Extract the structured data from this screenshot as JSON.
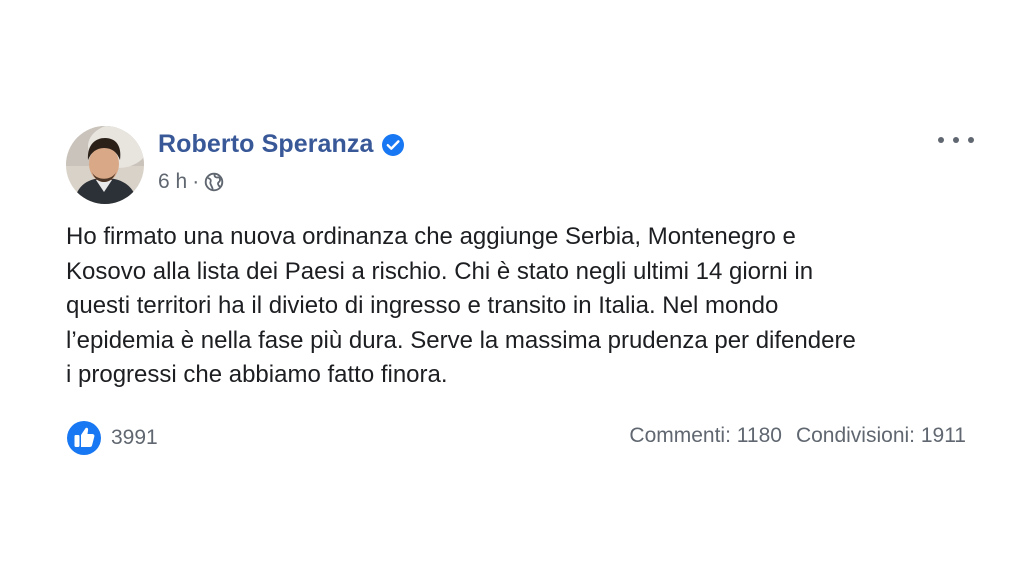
{
  "post": {
    "author_name": "Roberto Speranza",
    "verified": true,
    "time": "6 h",
    "separator": "·",
    "audience_icon": "globe-icon",
    "more_icon": "more-options-icon",
    "body_lines": [
      "Ho firmato una nuova ordinanza che aggiunge Serbia, Montenegro e",
      "Kosovo alla lista dei Paesi a rischio. Chi è stato negli ultimi 14 giorni in",
      "questi territori ha il divieto di ingresso e transito in Italia. Nel mondo",
      "l’epidemia è nella fase più dura. Serve la massima prudenza per difendere",
      "i progressi che abbiamo fatto finora."
    ]
  },
  "reactions": {
    "icon": "like-icon",
    "count": "3991"
  },
  "stats": {
    "comments": "Commenti: 1180",
    "shares": "Condivisioni: 1911"
  },
  "colors": {
    "name": "#385898",
    "verified_badge": "#1877f2",
    "like_badge": "#1877f2",
    "meta": "#606770",
    "text": "#1c1e21"
  }
}
